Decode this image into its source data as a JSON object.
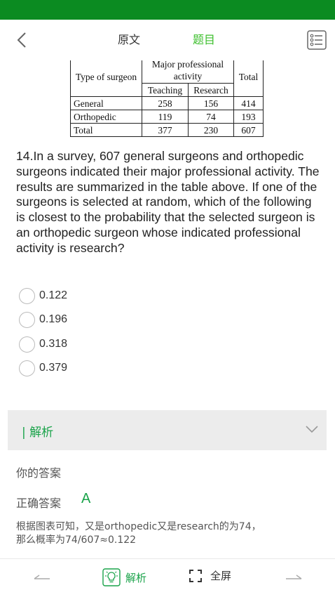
{
  "nav": {
    "back_icon": "chevron-left-icon",
    "tabs": [
      {
        "label": "原文",
        "active": false
      },
      {
        "label": "题目",
        "active": true
      }
    ],
    "menu_icon": "list-menu-icon"
  },
  "table": {
    "header": {
      "type": "Type of surgeon",
      "group": "Major professional activity",
      "teaching": "Teaching",
      "research": "Research",
      "total": "Total"
    },
    "rows": [
      {
        "label": "General",
        "teaching": "258",
        "research": "156",
        "total": "414"
      },
      {
        "label": "Orthopedic",
        "teaching": "119",
        "research": "74",
        "total": "193"
      },
      {
        "label": "Total",
        "teaching": "377",
        "research": "230",
        "total": "607"
      }
    ]
  },
  "question": {
    "text": "14.In a survey, 607 general surgeons and orthopedic surgeons indicated their major professional activity. The results are summarized in the table above. If one of the surgeons is selected at random, which of the following is closest to the probability that the selected surgeon is an orthopedic surgeon whose indicated professional activity is research?"
  },
  "options": [
    "0.122",
    "0.196",
    "0.318",
    "0.379"
  ],
  "analysis": {
    "title": "| 解析",
    "your_answer_label": "你的答案",
    "correct_label": "正确答案",
    "correct_value": "A",
    "explanation_line1": "根据图表可知，又是orthopedic又是research的为74，",
    "explanation_line2": "那么概率为74/607≈0.122"
  },
  "bottom": {
    "analysis_label": "解析",
    "fullscreen_label": "全屏"
  },
  "colors": {
    "status_bar": "#0b8b21",
    "accent": "#1aa34a",
    "tab_active": "#3cbf2c"
  }
}
